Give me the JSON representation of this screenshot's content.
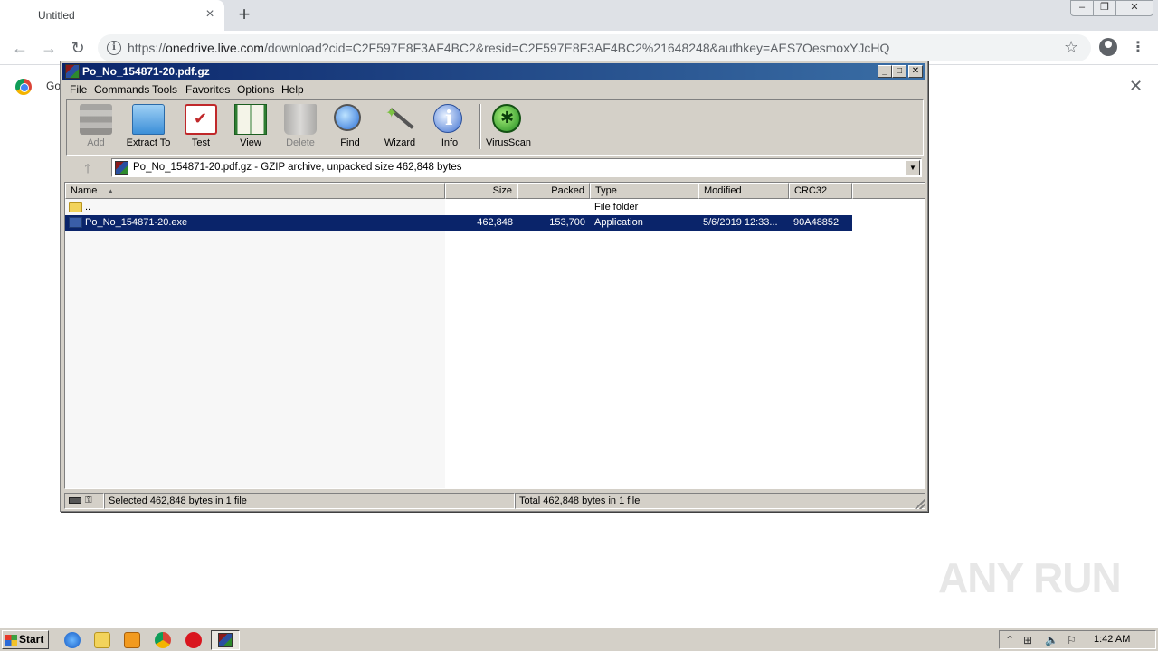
{
  "browser": {
    "tab_title": "Untitled",
    "url_prefix": "https://",
    "url_host": "onedrive.live.com",
    "url_rest": "/download?cid=C2F597E8F3AF4BC2&resid=C2F597E8F3AF4BC2%21648248&authkey=AES7OesmoxYJcHQ",
    "infobar_text": "Go"
  },
  "winrar": {
    "title": "Po_No_154871-20.pdf.gz",
    "menu": [
      "File",
      "Commands",
      "Tools",
      "Favorites",
      "Options",
      "Help"
    ],
    "tools": [
      "Add",
      "Extract To",
      "Test",
      "View",
      "Delete",
      "Find",
      "Wizard",
      "Info",
      "VirusScan"
    ],
    "address": "Po_No_154871-20.pdf.gz - GZIP archive, unpacked size 462,848 bytes",
    "columns": [
      "Name",
      "Size",
      "Packed",
      "Type",
      "Modified",
      "CRC32"
    ],
    "rows": [
      {
        "name": "..",
        "size": "",
        "packed": "",
        "type": "File folder",
        "modified": "",
        "crc": ""
      },
      {
        "name": "Po_No_154871-20.exe",
        "size": "462,848",
        "packed": "153,700",
        "type": "Application",
        "modified": "5/6/2019 12:33...",
        "crc": "90A48852"
      }
    ],
    "status_left": "Selected 462,848 bytes in 1 file",
    "status_right": "Total 462,848 bytes in 1 file"
  },
  "watermark": "ANY RUN",
  "taskbar": {
    "start_label": "Start",
    "clock": "1:42 AM"
  },
  "icons": {
    "sort": "▲",
    "up_arrow": "🡑",
    "dropdown": "▼"
  }
}
